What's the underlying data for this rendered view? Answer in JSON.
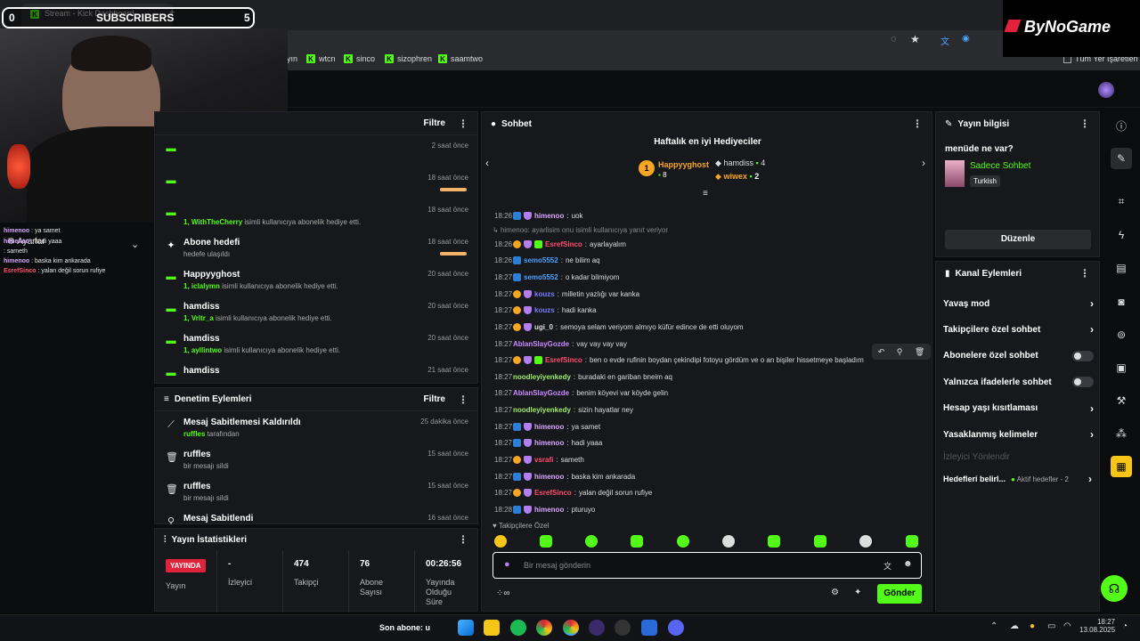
{
  "browser": {
    "tab_title": "Stream - Kick Dashboard",
    "new_tab": "+",
    "bookmarks": [
      "yın",
      "wtcn",
      "sinco",
      "sizophren",
      "saamtwo"
    ],
    "all_bookmarks": "Tüm Yer İşaretleri"
  },
  "overlay": {
    "sub_count_left": "0",
    "sub_label": "SUBSCRIBERS",
    "sub_count_right": "5",
    "brand": "ByNoGame",
    "left_menu_label": "Ayarlar",
    "overlay_chat": [
      {
        "user": "himenoo",
        "text": "ya samet"
      },
      {
        "user": "himenoo",
        "text": "hadi yaaa"
      },
      {
        "user": "",
        "text": "sameth"
      },
      {
        "user": "himenoo",
        "text": "baska kim ankarada"
      },
      {
        "user": "EsrefSinco",
        "text": "yalan değil sorun rufiye"
      }
    ]
  },
  "activity": {
    "filter_label": "Filtre",
    "items": [
      {
        "title": "",
        "sub_user": "",
        "sub_text": "",
        "time": "2 saat önce",
        "icon": "gift-icon",
        "bar": false
      },
      {
        "title": "",
        "sub_user": "",
        "sub_text": "",
        "time": "18 saat önce",
        "icon": "gift-icon",
        "bar": true
      },
      {
        "title": "",
        "sub_user": "1, WithTheCherry",
        "sub_text": " isimli kullanıcıya abonelik hediye etti.",
        "time": "18 saat önce",
        "icon": "gift-icon",
        "bar": false
      },
      {
        "title": "Abone hedefi",
        "sub_user": "",
        "sub_text": "hedefe ulaşıldı",
        "time": "18 saat önce",
        "icon": "sparkle-icon",
        "bar": true
      },
      {
        "title": "Happyyghost",
        "sub_user": "1, iclalymn",
        "sub_text": " isimli kullanıcıya abonelik hediye etti.",
        "time": "20 saat önce",
        "icon": "gift-icon",
        "bar": false
      },
      {
        "title": "hamdiss",
        "sub_user": "1, Vrltr_a",
        "sub_text": " isimli kullanıcıya abonelik hediye etti.",
        "time": "20 saat önce",
        "icon": "gift-icon",
        "bar": false
      },
      {
        "title": "hamdiss",
        "sub_user": "1, ayllintwo",
        "sub_text": " isimli kullanıcıya abonelik hediye etti.",
        "time": "20 saat önce",
        "icon": "gift-icon",
        "bar": false
      },
      {
        "title": "hamdiss",
        "sub_user": "",
        "sub_text": "",
        "time": "21 saat önce",
        "icon": "gift-icon",
        "bar": false
      }
    ]
  },
  "moderation": {
    "title": "Denetim Eylemleri",
    "filter_label": "Filtre",
    "items": [
      {
        "title": "Mesaj Sabitlemesi Kaldırıldı",
        "user": "ruffles",
        "text": " tarafından",
        "time": "25 dakika önce",
        "icon": "unpin-icon"
      },
      {
        "title": "ruffles",
        "user": "",
        "text": "bir mesajı sildi",
        "time": "15 saat önce",
        "icon": "trash-icon"
      },
      {
        "title": "ruffles",
        "user": "",
        "text": "bir mesajı sildi",
        "time": "15 saat önce",
        "icon": "trash-icon"
      },
      {
        "title": "Mesaj Sabitlendi",
        "user": "",
        "text": "",
        "time": "16 saat önce",
        "icon": "pin-icon"
      }
    ]
  },
  "stats": {
    "title": "Yayın İstatistikleri",
    "live_badge": "YAYINDA",
    "cols": [
      {
        "value": "",
        "label": "Yayın"
      },
      {
        "value": "-",
        "label": "İzleyici"
      },
      {
        "value": "474",
        "label": "Takipçi"
      },
      {
        "value": "76",
        "label": "Abone Sayısı"
      },
      {
        "value": "00:26:56",
        "label": "Yayında Olduğu Süre"
      }
    ]
  },
  "chat": {
    "title": "Sohbet",
    "gifters_title": "Haftalık en iyi Hediyeciler",
    "top_gifter": {
      "rank": "1",
      "name": "Happyyghost",
      "count": "8"
    },
    "gifters": [
      {
        "name": "hamdiss",
        "count": "4"
      },
      {
        "name": "wiwex",
        "count": "2"
      }
    ],
    "reply_hint": "himenoo: ayarlisim onu isimli kullanıcıya yanıt veriyor",
    "messages": [
      {
        "time": "18:26",
        "user": "himenoo",
        "color": "#d9a7ff",
        "text": "uok",
        "badges": [
          "blue",
          "purple"
        ]
      },
      {
        "time": "18:26",
        "user": "EsrefSinco",
        "color": "#ff4d6d",
        "text": "ayarlayalım",
        "badges": [
          "orange",
          "purple",
          "green"
        ]
      },
      {
        "time": "18:26",
        "user": "semo5552",
        "color": "#4aa3ff",
        "text": "ne bilim aq",
        "badges": [
          "blue"
        ]
      },
      {
        "time": "18:27",
        "user": "semo5552",
        "color": "#4aa3ff",
        "text": "o kadar bilmiyom",
        "badges": [
          "blue"
        ]
      },
      {
        "time": "18:27",
        "user": "kouzs",
        "color": "#7a7bff",
        "text": "milletin yazlığı var kanka",
        "badges": [
          "orange",
          "purple"
        ]
      },
      {
        "time": "18:27",
        "user": "kouzs",
        "color": "#7a7bff",
        "text": "hadi kanka",
        "badges": [
          "orange",
          "purple"
        ]
      },
      {
        "time": "18:27",
        "user": "ugi_0",
        "color": "#dddddd",
        "text": "semoya selam veriyom almıyo küfür edince de etti oluyom",
        "badges": [
          "orange",
          "purple"
        ]
      },
      {
        "time": "18:27",
        "user": "AblanSlayGozde",
        "color": "#c98bff",
        "text": "vay vay vay vay",
        "badges": []
      },
      {
        "time": "18:27",
        "user": "EsrefSinco",
        "color": "#ff4d6d",
        "text": "ben o evde rufinin boydan çekindipi fotoyu gördüm ve o an bişiler hissetmeye başladım",
        "badges": [
          "orange",
          "purple",
          "green"
        ]
      },
      {
        "time": "18:27",
        "user": "noodleyiyenkedy",
        "color": "#9ff06a",
        "text": "buradaki en gariban bneim aq",
        "badges": []
      },
      {
        "time": "18:27",
        "user": "AblanSlayGozde",
        "color": "#c98bff",
        "text": "benim köyevi var köyde gelin",
        "badges": []
      },
      {
        "time": "18:27",
        "user": "noodleyiyenkedy",
        "color": "#9ff06a",
        "text": "sizin hayatlar ney",
        "badges": []
      },
      {
        "time": "18:27",
        "user": "himenoo",
        "color": "#d9a7ff",
        "text": "ya samet",
        "badges": [
          "blue",
          "purple"
        ]
      },
      {
        "time": "18:27",
        "user": "himenoo",
        "color": "#d9a7ff",
        "text": "hadi yaaa",
        "badges": [
          "blue",
          "purple"
        ]
      },
      {
        "time": "18:27",
        "user": "vsrafi",
        "color": "#ff4d6d",
        "text": "sameth",
        "badges": [
          "orange",
          "purple"
        ]
      },
      {
        "time": "18:27",
        "user": "himenoo",
        "color": "#d9a7ff",
        "text": "baska kim ankarada",
        "badges": [
          "blue",
          "purple"
        ]
      },
      {
        "time": "18:27",
        "user": "EsrefSinco",
        "color": "#ff4d6d",
        "text": "yalan değil sorun rufiye",
        "badges": [
          "orange",
          "purple"
        ]
      },
      {
        "time": "18:28",
        "user": "himenoo",
        "color": "#d9a7ff",
        "text": "pturuyo",
        "badges": [
          "blue",
          "purple"
        ]
      }
    ],
    "follower_only_label": "Takipçilere Özel",
    "input_placeholder": "Bir mesaj gönderin",
    "send_label": "Gönder"
  },
  "stream_info": {
    "title": "Yayın bilgisi",
    "stream_title": "menüde ne var?",
    "category": "Sadece Sohbet",
    "language": "Turkish",
    "edit_label": "Düzenle"
  },
  "channel_actions": {
    "title": "Kanal Eylemleri",
    "rows": [
      {
        "label": "Yavaş mod",
        "control": "chevron"
      },
      {
        "label": "Takipçilere özel sohbet",
        "control": "chevron"
      },
      {
        "label": "Abonelere özel sohbet",
        "control": "toggle"
      },
      {
        "label": "Yalnızca ifadelerle sohbet",
        "control": "toggle"
      },
      {
        "label": "Hesap yaşı kısıtlaması",
        "control": "chevron"
      },
      {
        "label": "Yasaklanmış kelimeler",
        "control": "chevron"
      }
    ],
    "viewer_redirect": "İzleyici Yönlendir",
    "goals_label": "Hedefleri belirl...",
    "goals_status": "Aktif hedefler - 2"
  },
  "taskbar": {
    "last_sub": "Son abone: u",
    "time": "18:27",
    "date": "13.08.2025"
  },
  "colors": {
    "accent": "#53fc18",
    "live_red": "#e0223a"
  }
}
